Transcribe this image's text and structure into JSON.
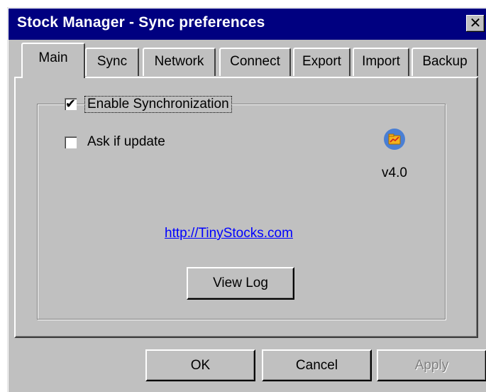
{
  "window": {
    "title": "Stock Manager - Sync preferences",
    "close_glyph": "✕"
  },
  "tabs": [
    {
      "label": "Main",
      "active": true
    },
    {
      "label": "Sync",
      "active": false
    },
    {
      "label": "Network",
      "active": false
    },
    {
      "label": "Connect",
      "active": false
    },
    {
      "label": "Export",
      "active": false
    },
    {
      "label": "Import",
      "active": false
    },
    {
      "label": "Backup",
      "active": false
    }
  ],
  "main": {
    "enable_sync": {
      "label": "Enable Synchronization",
      "checked": true
    },
    "ask_update": {
      "label": "Ask if update",
      "checked": false
    },
    "app_icon": "folder-chart-icon",
    "version": "v4.0",
    "link": "http://TinyStocks.com",
    "view_log_label": "View Log"
  },
  "buttons": {
    "ok": "OK",
    "cancel": "Cancel",
    "apply": "Apply",
    "apply_enabled": false
  },
  "colors": {
    "titlebar": "#000080",
    "face": "#c0c0c0",
    "link": "#0000ff",
    "icon_circle": "#4a7fd4",
    "icon_folder": "#f5b21c"
  }
}
